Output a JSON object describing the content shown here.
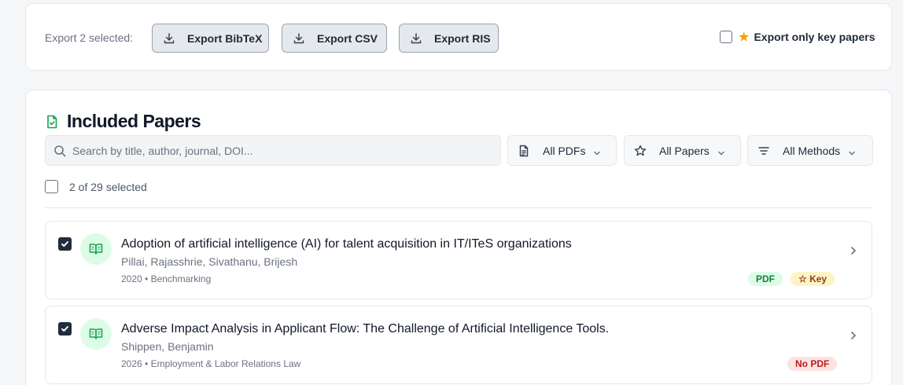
{
  "export": {
    "label": "Export 2 selected:",
    "buttons": {
      "bibtex": "Export BibTeX",
      "csv": "Export CSV",
      "ris": "Export RIS"
    },
    "key_only_label": "Export only key papers",
    "key_only_checked": false
  },
  "section": {
    "title": "Included Papers"
  },
  "search": {
    "placeholder": "Search by title, author, journal, DOI...",
    "value": ""
  },
  "filters": {
    "pdf": "All PDFs",
    "papers": "All Papers",
    "methods": "All Methods"
  },
  "selection": {
    "text": "2 of 29 selected"
  },
  "papers": [
    {
      "title": "Adoption of artificial intelligence (AI) for talent acquisition in IT/ITeS organizations",
      "authors": "Pillai, Rajasshrie, Sivathanu, Brijesh",
      "meta": "2020 • Benchmarking",
      "checked": true,
      "badges": [
        "PDF",
        "☆ Key"
      ]
    },
    {
      "title": "Adverse Impact Analysis in Applicant Flow: The Challenge of Artificial Intelligence Tools.",
      "authors": "Shippen, Benjamin",
      "meta": "2026 • Employment & Labor Relations Law",
      "checked": true,
      "badges": [
        "No PDF"
      ]
    }
  ],
  "colors": {
    "accent_green": "#16a34a",
    "checkbox_dark": "#1f2d3d",
    "star": "#f59e0b"
  }
}
